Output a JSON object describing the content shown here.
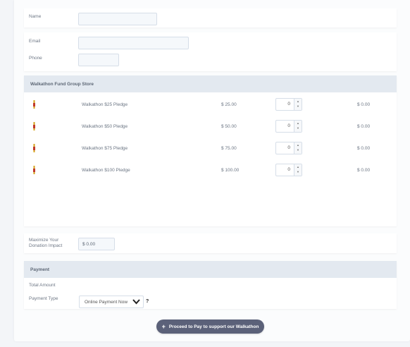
{
  "contact": {
    "name_label": "Name",
    "email_label": "Email",
    "phone_label": "Phone"
  },
  "store": {
    "title": "Walkathon Fund Group Store",
    "items": [
      {
        "name": "Walkathon $25 Pledge",
        "price": "$ 25.00",
        "qty": "0",
        "total": "$ 0.00",
        "icon": "pledge-icon"
      },
      {
        "name": "Walkathon $50 Pledge",
        "price": "$ 50.00",
        "qty": "0",
        "total": "$ 0.00",
        "icon": "pledge-icon"
      },
      {
        "name": "Walkathon $75 Pledge",
        "price": "$ 75.00",
        "qty": "0",
        "total": "$ 0.00",
        "icon": "pledge-icon"
      },
      {
        "name": "Walkathon $100 Pledge",
        "price": "$ 100.00",
        "qty": "0",
        "total": "$ 0.00",
        "icon": "pledge-icon"
      }
    ]
  },
  "donation": {
    "label_line1": "Maximize Your",
    "label_line2": "Donation Impact",
    "value": "$ 0.00"
  },
  "payment": {
    "title": "Payment",
    "total_label": "Total Amount",
    "type_label": "Payment Type",
    "type_value": "Online Payment Now",
    "help": "?"
  },
  "proceed": {
    "label": "Proceed to Pay to support our Walkathon",
    "icon": "plus-icon"
  },
  "colors": {
    "section_header": "#e3e9f0",
    "button": "#5b6179",
    "icon_red": "#c0392b",
    "icon_gold": "#d4a017"
  }
}
